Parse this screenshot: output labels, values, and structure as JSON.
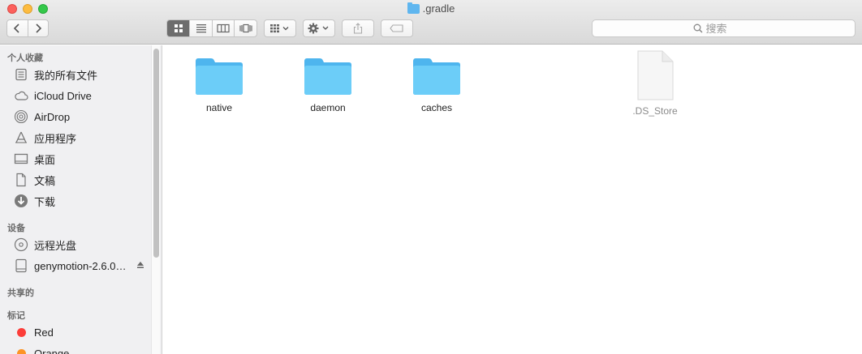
{
  "window": {
    "title": ".gradle"
  },
  "toolbar": {
    "back_icon": "chevron-left-icon",
    "forward_icon": "chevron-right-icon",
    "view_modes": [
      "icon-view",
      "list-view",
      "column-view",
      "coverflow-view"
    ],
    "active_view": "icon-view",
    "search_placeholder": "搜索"
  },
  "sidebar": {
    "favorites_title": "个人收藏",
    "favorites": [
      {
        "label": "我的所有文件",
        "icon": "all-files-icon"
      },
      {
        "label": "iCloud Drive",
        "icon": "cloud-icon"
      },
      {
        "label": "AirDrop",
        "icon": "airdrop-icon"
      },
      {
        "label": "应用程序",
        "icon": "applications-icon"
      },
      {
        "label": "桌面",
        "icon": "desktop-icon"
      },
      {
        "label": "文稿",
        "icon": "documents-icon"
      },
      {
        "label": "下载",
        "icon": "downloads-icon"
      }
    ],
    "devices_title": "设备",
    "devices": [
      {
        "label": "远程光盘",
        "icon": "disc-icon"
      },
      {
        "label": "genymotion-2.6.0…",
        "icon": "drive-icon",
        "ejectable": true
      }
    ],
    "shared_title": "共享的",
    "tags_title": "标记",
    "tags": [
      {
        "label": "Red",
        "color": "#fc3d39"
      },
      {
        "label": "Orange",
        "color": "#fd9426"
      }
    ]
  },
  "files": [
    {
      "name": "native",
      "kind": "folder"
    },
    {
      "name": "daemon",
      "kind": "folder"
    },
    {
      "name": "caches",
      "kind": "folder"
    },
    {
      "name": ".DS_Store",
      "kind": "document"
    }
  ],
  "colors": {
    "folder": "#5ec0f5",
    "folder_tab": "#7fd0f8",
    "active_segment": "#6d6d6d"
  }
}
